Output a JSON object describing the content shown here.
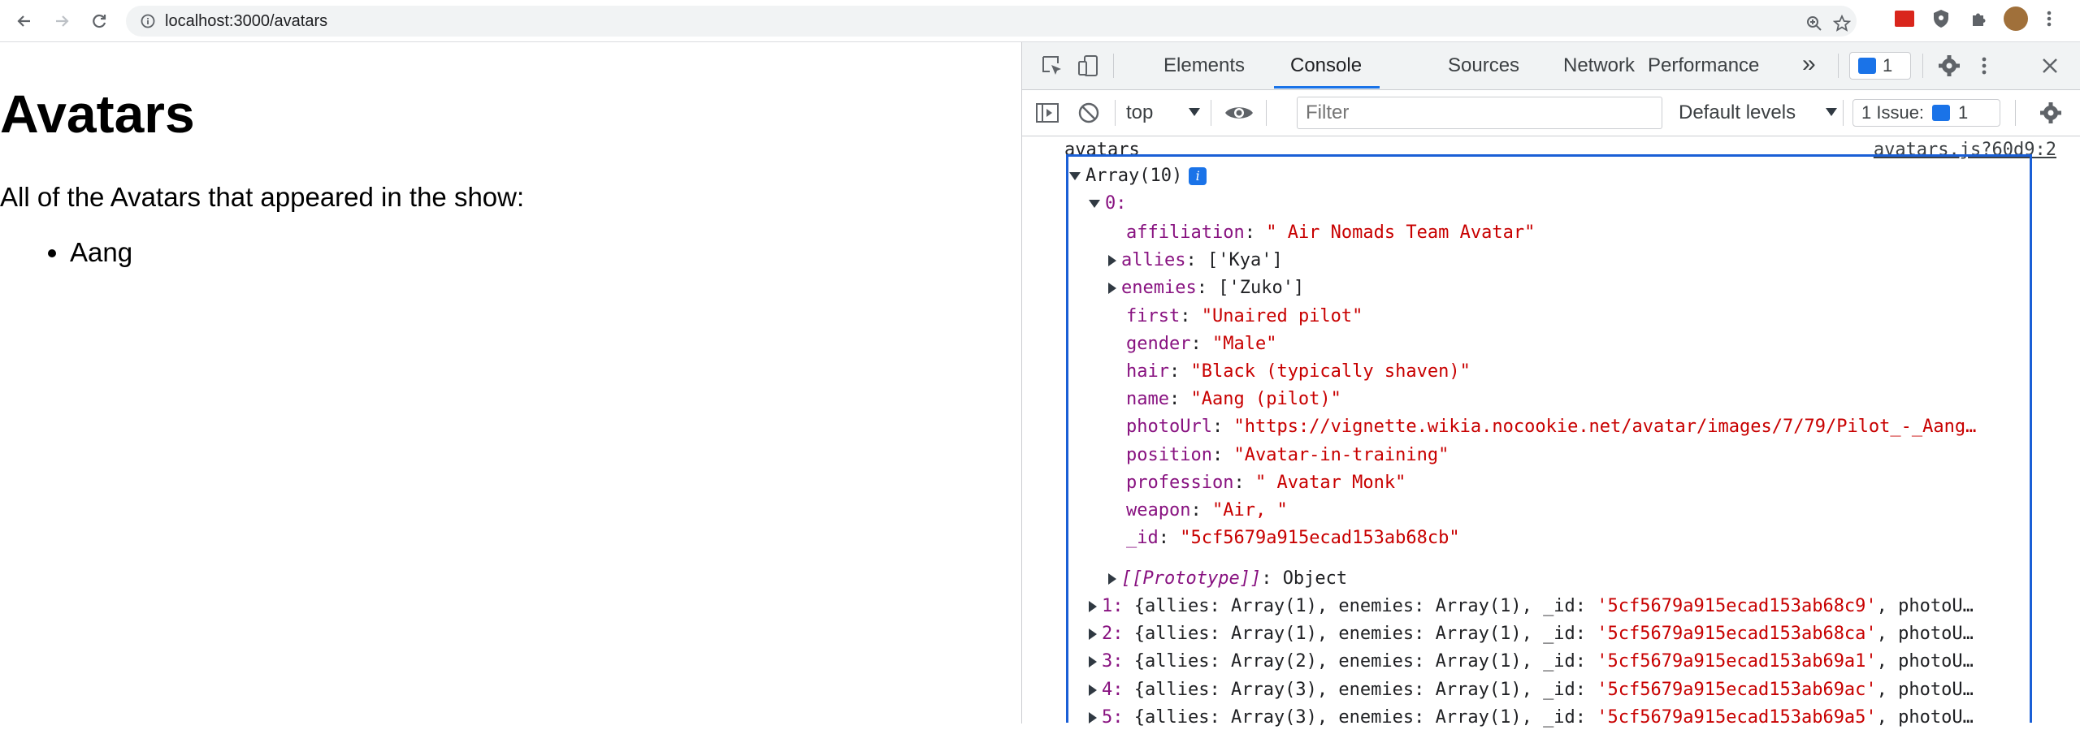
{
  "browser": {
    "url": "localhost:3000/avatars"
  },
  "page": {
    "title": "Avatars",
    "intro": "All of the Avatars that appeared in the show:",
    "list": [
      "Aang"
    ]
  },
  "devtools": {
    "tabs": [
      "Elements",
      "Console",
      "Sources",
      "Network",
      "Performance"
    ],
    "active_tab": "Console",
    "more_tabs": "»",
    "issues_badge_count": "1",
    "context": "top",
    "filter_placeholder": "Filter",
    "levels": "Default levels",
    "issues_label": "1 Issue:",
    "issues_count": "1"
  },
  "console": {
    "log_label": "avatars",
    "source": "avatars.js?60d9:2",
    "array_header": "Array(10)",
    "item0_index": "0:",
    "item0_fields": [
      {
        "key": "affiliation",
        "sep": ": ",
        "value": "\" Air Nomads Team Avatar\"",
        "expandable": false
      },
      {
        "key": "allies",
        "sep": ": ",
        "value": "['Kya']",
        "expandable": true
      },
      {
        "key": "enemies",
        "sep": ": ",
        "value": "['Zuko']",
        "expandable": true
      },
      {
        "key": "first",
        "sep": ": ",
        "value": "\"Unaired pilot\"",
        "expandable": false
      },
      {
        "key": "gender",
        "sep": ": ",
        "value": "\"Male\"",
        "expandable": false
      },
      {
        "key": "hair",
        "sep": ": ",
        "value": "\"Black (typically shaven)\"",
        "expandable": false
      },
      {
        "key": "name",
        "sep": ": ",
        "value": "\"Aang (pilot)\"",
        "expandable": false
      },
      {
        "key": "photoUrl",
        "sep": ": ",
        "value": "\"https://vignette.wikia.nocookie.net/avatar/images/7/79/Pilot_-_Aang…",
        "expandable": false
      },
      {
        "key": "position",
        "sep": ": ",
        "value": "\"Avatar-in-training\"",
        "expandable": false
      },
      {
        "key": "profession",
        "sep": ": ",
        "value": "\" Avatar Monk\"",
        "expandable": false
      },
      {
        "key": "weapon",
        "sep": ": ",
        "value": "\"Air, \"",
        "expandable": false
      },
      {
        "key": "_id",
        "sep": ": ",
        "value": "\"5cf5679a915ecad153ab68cb\"",
        "expandable": false
      }
    ],
    "prototype_key": "[[Prototype]]",
    "prototype_value": "Object",
    "collapsed_items": [
      {
        "index": "1:",
        "body": "{allies: Array(1), enemies: Array(1), _id: ",
        "id": "'5cf5679a915ecad153ab68c9'",
        "tail": ", photoU…"
      },
      {
        "index": "2:",
        "body": "{allies: Array(1), enemies: Array(1), _id: ",
        "id": "'5cf5679a915ecad153ab68ca'",
        "tail": ", photoU…"
      },
      {
        "index": "3:",
        "body": "{allies: Array(2), enemies: Array(1), _id: ",
        "id": "'5cf5679a915ecad153ab69a1'",
        "tail": ", photoU…"
      },
      {
        "index": "4:",
        "body": "{allies: Array(3), enemies: Array(1), _id: ",
        "id": "'5cf5679a915ecad153ab69ac'",
        "tail": ", photoU…"
      },
      {
        "index": "5:",
        "body": "{allies: Array(3), enemies: Array(1), _id: ",
        "id": "'5cf5679a915ecad153ab69a5'",
        "tail": ", photoU…"
      }
    ]
  },
  "colors": {
    "accent": "#1a73e8",
    "key": "#881280",
    "string": "#c80000"
  }
}
